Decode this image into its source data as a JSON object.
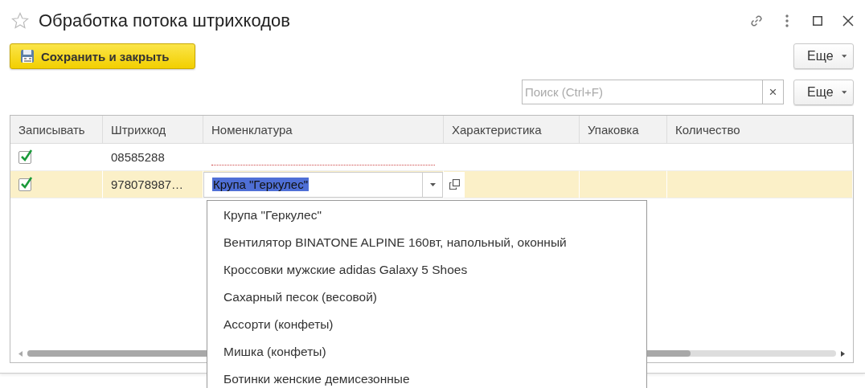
{
  "window": {
    "title": "Обработка потока штрихкодов"
  },
  "toolbar": {
    "save_button": "Сохранить и закрыть",
    "more_button": "Еще"
  },
  "search": {
    "placeholder": "Поиск (Ctrl+F)",
    "clear": "×",
    "more_button": "Еще"
  },
  "table": {
    "columns": [
      "Записывать",
      "Штрихкод",
      "Номенклатура",
      "Характеристика",
      "Упаковка",
      "Количество"
    ],
    "rows": [
      {
        "checked": true,
        "barcode": "08585288",
        "selected": false
      },
      {
        "checked": true,
        "barcode": "978078987…",
        "item": "Крупа \"Геркулес\"",
        "selected": true
      }
    ]
  },
  "dropdown": {
    "items": [
      "Крупа \"Геркулес\"",
      "Вентилятор BINATONE ALPINE 160вт, напольный, оконный",
      "Кроссовки мужские adidas Galaxy 5 Shoes",
      "Сахарный песок (весовой)",
      "Ассорти (конфеты)",
      "Мишка (конфеты)",
      "Ботинки женские демисезонные"
    ]
  }
}
